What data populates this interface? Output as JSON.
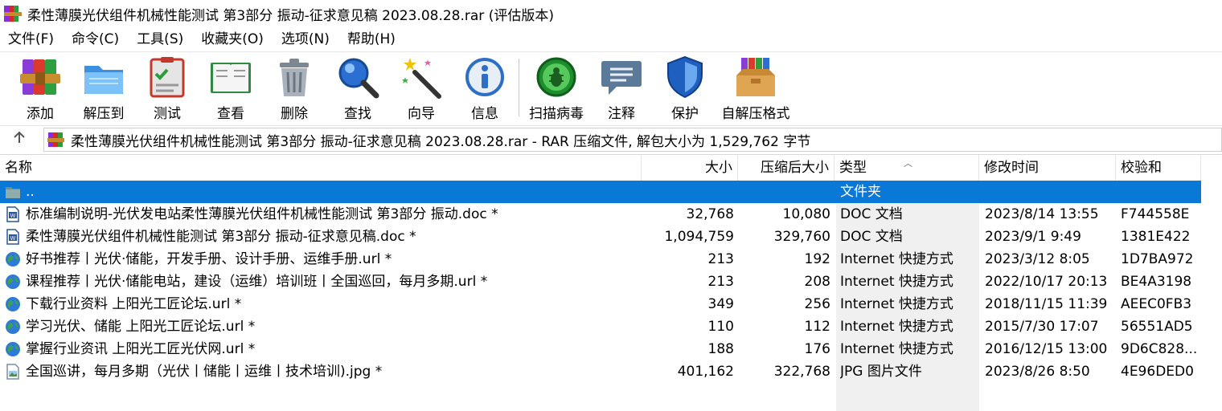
{
  "window": {
    "title": "柔性薄膜光伏组件机械性能测试 第3部分 振动-征求意见稿 2023.08.28.rar (评估版本)"
  },
  "menu": [
    {
      "label": "文件(F)"
    },
    {
      "label": "命令(C)"
    },
    {
      "label": "工具(S)"
    },
    {
      "label": "收藏夹(O)"
    },
    {
      "label": "选项(N)"
    },
    {
      "label": "帮助(H)"
    }
  ],
  "toolbar": [
    {
      "label": "添加",
      "icon": "books-stack-icon"
    },
    {
      "label": "解压到",
      "icon": "folder-icon"
    },
    {
      "label": "测试",
      "icon": "checklist-icon"
    },
    {
      "label": "查看",
      "icon": "open-book-icon"
    },
    {
      "label": "删除",
      "icon": "trash-can-icon"
    },
    {
      "label": "查找",
      "icon": "magnifier-icon"
    },
    {
      "label": "向导",
      "icon": "magic-wand-icon"
    },
    {
      "label": "信息",
      "icon": "info-icon"
    },
    {
      "label": "扫描病毒",
      "icon": "bug-scan-icon"
    },
    {
      "label": "注释",
      "icon": "comment-icon"
    },
    {
      "label": "保护",
      "icon": "shield-icon"
    },
    {
      "label": "自解压格式",
      "icon": "sfx-box-icon"
    }
  ],
  "address": {
    "text": "柔性薄膜光伏组件机械性能测试 第3部分 振动-征求意见稿 2023.08.28.rar - RAR 压缩文件, 解包大小为 1,529,762 字节"
  },
  "columns": {
    "name": "名称",
    "size": "大小",
    "packed": "压缩后大小",
    "type": "类型",
    "modified": "修改时间",
    "crc": "校验和"
  },
  "files": [
    {
      "name": "..",
      "size": "",
      "packed": "",
      "type": "文件夹",
      "modified": "",
      "crc": "",
      "icon": "folder-icon",
      "selected": true
    },
    {
      "name": "标准编制说明-光伏发电站柔性薄膜光伏组件机械性能测试 第3部分 振动.doc *",
      "size": "32,768",
      "packed": "10,080",
      "type": "DOC 文档",
      "modified": "2023/8/14 13:55",
      "crc": "F744558E",
      "icon": "word-doc-icon"
    },
    {
      "name": "柔性薄膜光伏组件机械性能测试 第3部分 振动-征求意见稿.doc *",
      "size": "1,094,759",
      "packed": "329,760",
      "type": "DOC 文档",
      "modified": "2023/9/1 9:49",
      "crc": "1381E422",
      "icon": "word-doc-icon"
    },
    {
      "name": "好书推荐丨光伏·储能，开发手册、设计手册、运维手册.url *",
      "size": "213",
      "packed": "192",
      "type": "Internet 快捷方式",
      "modified": "2023/3/12 8:05",
      "crc": "1D7BA972",
      "icon": "globe-icon"
    },
    {
      "name": "课程推荐丨光伏·储能电站，建设（运维）培训班丨全国巡回，每月多期.url *",
      "size": "213",
      "packed": "208",
      "type": "Internet 快捷方式",
      "modified": "2022/10/17 20:13",
      "crc": "BE4A3198",
      "icon": "globe-icon"
    },
    {
      "name": "下载行业资料 上阳光工匠论坛.url *",
      "size": "349",
      "packed": "256",
      "type": "Internet 快捷方式",
      "modified": "2018/11/15 11:39",
      "crc": "AEEC0FB3",
      "icon": "globe-icon"
    },
    {
      "name": "学习光伏、储能 上阳光工匠论坛.url *",
      "size": "110",
      "packed": "112",
      "type": "Internet 快捷方式",
      "modified": "2015/7/30 17:07",
      "crc": "56551AD5",
      "icon": "globe-icon"
    },
    {
      "name": "掌握行业资讯 上阳光工匠光伏网.url *",
      "size": "188",
      "packed": "176",
      "type": "Internet 快捷方式",
      "modified": "2016/12/15 13:00",
      "crc": "9D6C828...",
      "icon": "globe-icon"
    },
    {
      "name": "全国巡讲，每月多期（光伏丨储能丨运维丨技术培训).jpg *",
      "size": "401,162",
      "packed": "322,768",
      "type": "JPG 图片文件",
      "modified": "2023/8/26 8:50",
      "crc": "4E96DED0",
      "icon": "image-file-icon"
    }
  ]
}
